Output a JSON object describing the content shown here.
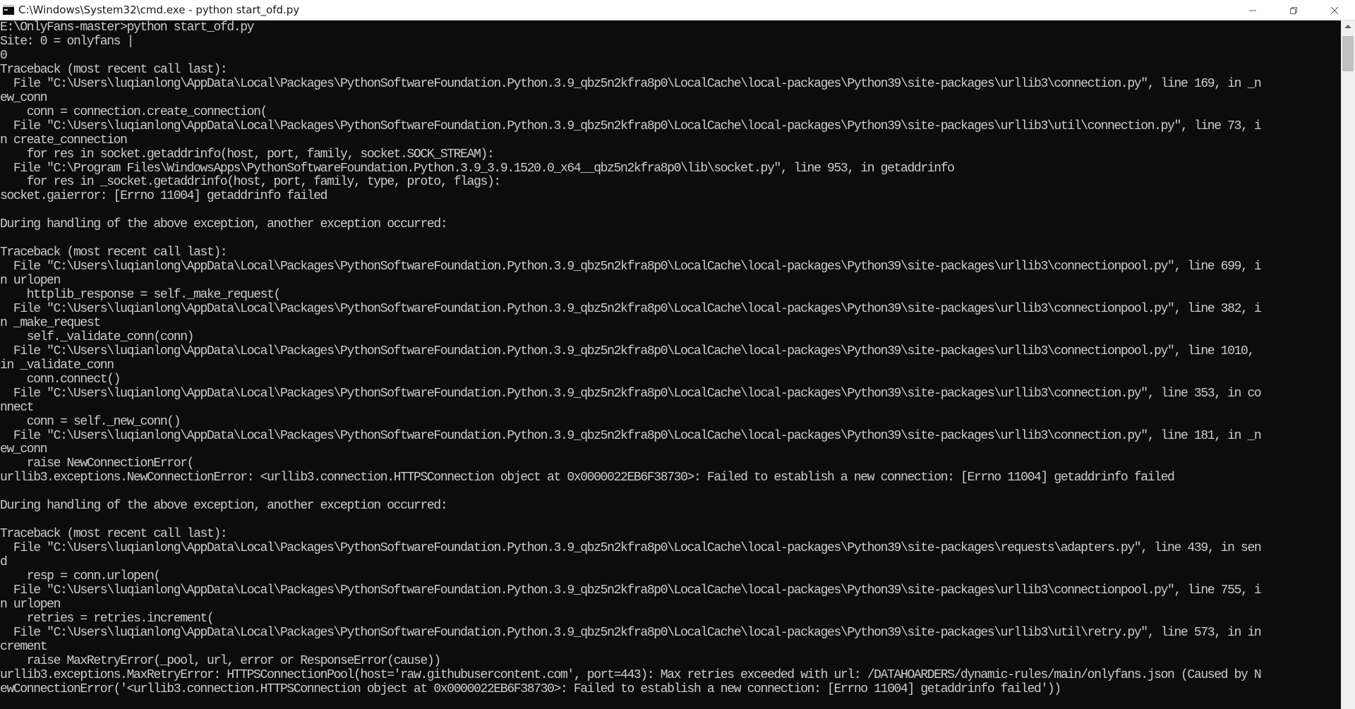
{
  "window": {
    "title": "C:\\Windows\\System32\\cmd.exe - python  start_ofd.py",
    "icon": "cmd-icon",
    "controls": [
      "minimize-icon",
      "restore-icon",
      "close-icon"
    ]
  },
  "terminal": {
    "colors": {
      "background": "#0c0c0c",
      "foreground": "#cccccc"
    },
    "lines": [
      "E:\\OnlyFans-master>python start_ofd.py",
      "Site: 0 = onlyfans |",
      "0",
      "Traceback (most recent call last):",
      "  File \"C:\\Users\\luqianlong\\AppData\\Local\\Packages\\PythonSoftwareFoundation.Python.3.9_qbz5n2kfra8p0\\LocalCache\\local-packages\\Python39\\site-packages\\urllib3\\connection.py\", line 169, in _n",
      "ew_conn",
      "    conn = connection.create_connection(",
      "  File \"C:\\Users\\luqianlong\\AppData\\Local\\Packages\\PythonSoftwareFoundation.Python.3.9_qbz5n2kfra8p0\\LocalCache\\local-packages\\Python39\\site-packages\\urllib3\\util\\connection.py\", line 73, i",
      "n create_connection",
      "    for res in socket.getaddrinfo(host, port, family, socket.SOCK_STREAM):",
      "  File \"C:\\Program Files\\WindowsApps\\PythonSoftwareFoundation.Python.3.9_3.9.1520.0_x64__qbz5n2kfra8p0\\lib\\socket.py\", line 953, in getaddrinfo",
      "    for res in _socket.getaddrinfo(host, port, family, type, proto, flags):",
      "socket.gaierror: [Errno 11004] getaddrinfo failed",
      "",
      "During handling of the above exception, another exception occurred:",
      "",
      "Traceback (most recent call last):",
      "  File \"C:\\Users\\luqianlong\\AppData\\Local\\Packages\\PythonSoftwareFoundation.Python.3.9_qbz5n2kfra8p0\\LocalCache\\local-packages\\Python39\\site-packages\\urllib3\\connectionpool.py\", line 699, i",
      "n urlopen",
      "    httplib_response = self._make_request(",
      "  File \"C:\\Users\\luqianlong\\AppData\\Local\\Packages\\PythonSoftwareFoundation.Python.3.9_qbz5n2kfra8p0\\LocalCache\\local-packages\\Python39\\site-packages\\urllib3\\connectionpool.py\", line 382, i",
      "n _make_request",
      "    self._validate_conn(conn)",
      "  File \"C:\\Users\\luqianlong\\AppData\\Local\\Packages\\PythonSoftwareFoundation.Python.3.9_qbz5n2kfra8p0\\LocalCache\\local-packages\\Python39\\site-packages\\urllib3\\connectionpool.py\", line 1010,",
      "in _validate_conn",
      "    conn.connect()",
      "  File \"C:\\Users\\luqianlong\\AppData\\Local\\Packages\\PythonSoftwareFoundation.Python.3.9_qbz5n2kfra8p0\\LocalCache\\local-packages\\Python39\\site-packages\\urllib3\\connection.py\", line 353, in co",
      "nnect",
      "    conn = self._new_conn()",
      "  File \"C:\\Users\\luqianlong\\AppData\\Local\\Packages\\PythonSoftwareFoundation.Python.3.9_qbz5n2kfra8p0\\LocalCache\\local-packages\\Python39\\site-packages\\urllib3\\connection.py\", line 181, in _n",
      "ew_conn",
      "    raise NewConnectionError(",
      "urllib3.exceptions.NewConnectionError: <urllib3.connection.HTTPSConnection object at 0x0000022EB6F38730>: Failed to establish a new connection: [Errno 11004] getaddrinfo failed",
      "",
      "During handling of the above exception, another exception occurred:",
      "",
      "Traceback (most recent call last):",
      "  File \"C:\\Users\\luqianlong\\AppData\\Local\\Packages\\PythonSoftwareFoundation.Python.3.9_qbz5n2kfra8p0\\LocalCache\\local-packages\\Python39\\site-packages\\requests\\adapters.py\", line 439, in sen",
      "d",
      "    resp = conn.urlopen(",
      "  File \"C:\\Users\\luqianlong\\AppData\\Local\\Packages\\PythonSoftwareFoundation.Python.3.9_qbz5n2kfra8p0\\LocalCache\\local-packages\\Python39\\site-packages\\urllib3\\connectionpool.py\", line 755, i",
      "n urlopen",
      "    retries = retries.increment(",
      "  File \"C:\\Users\\luqianlong\\AppData\\Local\\Packages\\PythonSoftwareFoundation.Python.3.9_qbz5n2kfra8p0\\LocalCache\\local-packages\\Python39\\site-packages\\urllib3\\util\\retry.py\", line 573, in in",
      "crement",
      "    raise MaxRetryError(_pool, url, error or ResponseError(cause))",
      "urllib3.exceptions.MaxRetryError: HTTPSConnectionPool(host='raw.githubusercontent.com', port=443): Max retries exceeded with url: /DATAHOARDERS/dynamic-rules/main/onlyfans.json (Caused by N",
      "ewConnectionError('<urllib3.connection.HTTPSConnection object at 0x0000022EB6F38730>: Failed to establish a new connection: [Errno 11004] getaddrinfo failed'))"
    ]
  }
}
